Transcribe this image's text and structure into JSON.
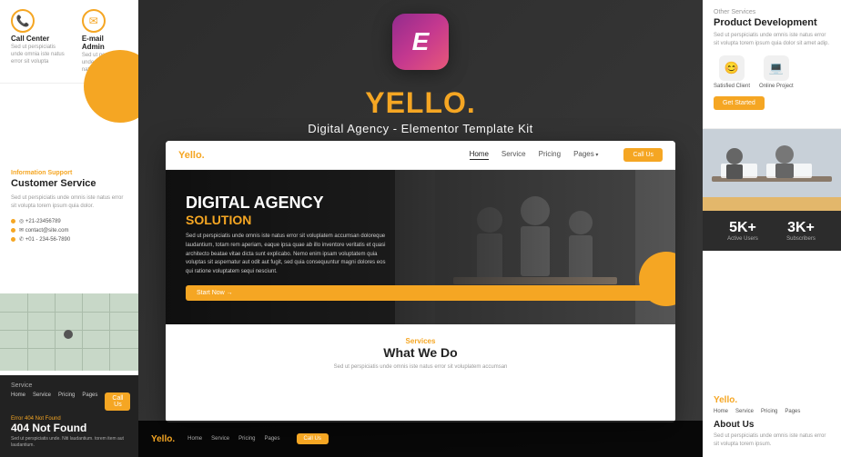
{
  "left": {
    "call_center_label": "Call Center",
    "email_admin_label": "E-mail Admin",
    "call_sub": "Sed ut perspiciatis unde omnia iste natus error sit volupta",
    "email_sub": "Sed ut perspiciatis unde omnia iste natus error",
    "info_tag": "Information Support",
    "info_title": "Customer Service",
    "info_body": "Sed ut perspiciatis unde omnis iste natus error sit volupta torem ipsum quia dolor.",
    "contact1": "◎ +21-23456789",
    "contact2": "✉ contact@site.com",
    "contact3": "✆ +01 - 234-56-7890",
    "service_tag": "Service",
    "nav_home": "Home",
    "nav_service": "Service",
    "nav_pricing": "Pricing",
    "nav_pages": "Pages",
    "cta_label": "Call Us",
    "error_tag": "Error 404 Not Found",
    "error_title": "404 Not Found",
    "error_body": "Sed ut perspiciatis unde. Niti laudantium. torem item aut laudantium."
  },
  "center": {
    "elementor_letter": "E",
    "brand_name": "YELLO.",
    "brand_tagline": "Digital Agency - Elementor Template Kit",
    "inner_nav_brand": "Yello.",
    "nav_home": "Home",
    "nav_service": "Service",
    "nav_pricing": "Pricing",
    "nav_pages": "Pages",
    "cta_label": "Call Us",
    "hero_title": "DIGITAL AGENCY",
    "hero_subtitle": "SOLUTION",
    "hero_body": "Sed ut perspiciatis unde omnis iste natus error sit voluplatem accumsan doloreque laudantium, totam rem aperiam, eaque ipsa quae ab illo inventore veritatis et quasi architecto beatae vitae dicta sunt explicabo. Nemo enim ipsam voluptatem quia voluptas sit aspernatur aut odit aut fugit, sed quia consequuntur magni dolores eos qui ratione voluptatem sequi nesciunt.",
    "hero_btn": "Start Now →",
    "services_tag": "Services",
    "services_title": "What We Do",
    "services_body": "Sed ut perspiciatis unde omnis iste natus error sit voluplatem accumsan",
    "bottom_brand": "Yello.",
    "bottom_home": "Home",
    "bottom_service": "Service",
    "bottom_pricing": "Pricing",
    "bottom_pages": "Pages",
    "bottom_cta": "Call Us"
  },
  "right": {
    "other_tag": "Other Services",
    "title": "Product Development",
    "body": "Sed ut perspiciatis unde omnis iste natus error sit volupta torem ipsum quia dolor sit amet adip.",
    "icon1_label": "Satisfied Client",
    "icon2_label": "Online Project",
    "cta_label": "Get Started",
    "stats_number1": "5K+",
    "stats_label1": "Active Users",
    "stats_number2": "3K+",
    "stats_label2": "Subscribers",
    "bottom_brand": "Yello.",
    "bottom_home": "Home",
    "bottom_service": "Service",
    "bottom_pricing": "Pricing",
    "bottom_pages": "Pages",
    "about_title": "About Us",
    "about_body": "Sed ut perspiciatis unde omnis iste natus error sit volupta torem ipsum."
  }
}
